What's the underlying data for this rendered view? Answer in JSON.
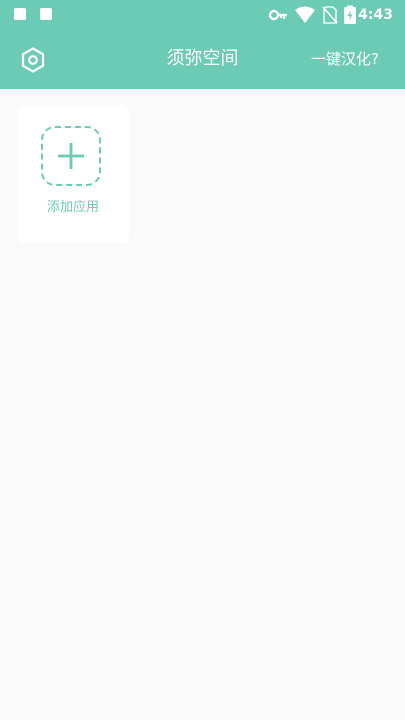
{
  "status_bar": {
    "time": "4:43",
    "icons": [
      "notification-icon",
      "notification-icon",
      "vpn-key-icon",
      "wifi-icon",
      "no-sim-icon",
      "battery-icon"
    ]
  },
  "app_bar": {
    "title": "须弥空间",
    "translate_label": "一键汉化?",
    "settings_icon": "gear-icon"
  },
  "apps": {
    "add_label": "添加应用",
    "add_icon": "plus-icon"
  },
  "colors": {
    "accent": "#6ccbb4",
    "background": "#fafafa",
    "card": "#ffffff"
  }
}
